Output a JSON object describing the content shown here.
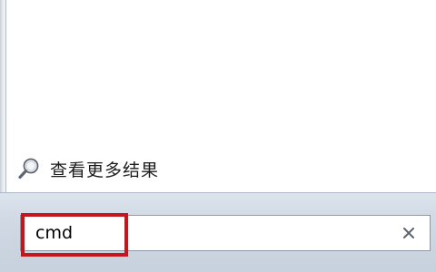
{
  "results": {
    "see_more_label": "查看更多结果",
    "icon": "search-magnifier-icon"
  },
  "search": {
    "value": "cmd",
    "clear_icon": "close-x-icon"
  },
  "colors": {
    "highlight": "#c4161c",
    "pane_top": "#dbe3ec",
    "pane_bottom": "#c7d1dc"
  }
}
